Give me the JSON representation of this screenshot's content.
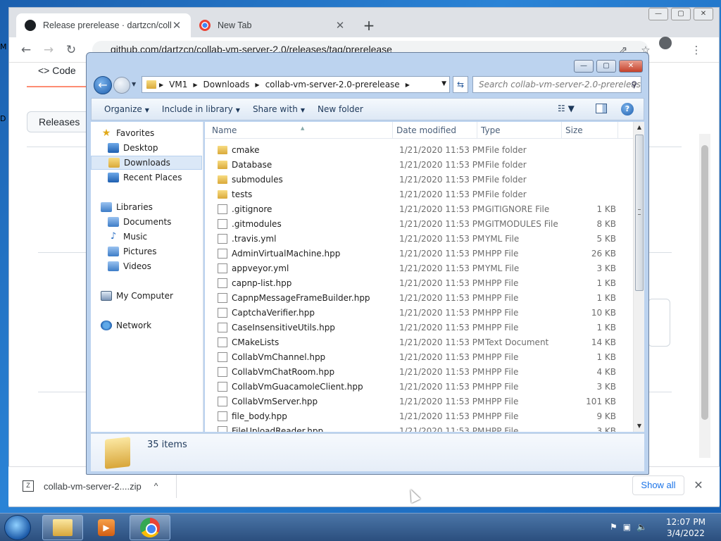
{
  "browser": {
    "tabs": [
      {
        "title": "Release prerelease · dartzcn/colla",
        "close": "✕"
      },
      {
        "title": "New Tab",
        "close": "✕"
      }
    ],
    "new_tab": "+",
    "address": "github.com/dartzcn/collab-vm-server-2.0/releases/tag/prerelease",
    "window_controls": [
      "—",
      "▢",
      "✕"
    ]
  },
  "github": {
    "code_tab": "<> Code",
    "releases_button": "Releases"
  },
  "left_edge": {
    "m": "M",
    "d": "D"
  },
  "download_bar": {
    "file": "collab-vm-server-2....zip",
    "caret": "^",
    "show_all": "Show all",
    "close": "✕"
  },
  "explorer": {
    "controls": [
      "—",
      "▢",
      "✕"
    ],
    "breadcrumb": [
      "VM1",
      "Downloads",
      "collab-vm-server-2.0-prerelease"
    ],
    "search_placeholder": "Search collab-vm-server-2.0-prerelease",
    "commands": {
      "organize": "Organize",
      "include": "Include in library",
      "share": "Share with",
      "new_folder": "New folder"
    },
    "nav": {
      "favorites": "Favorites",
      "desktop": "Desktop",
      "downloads": "Downloads",
      "recent": "Recent Places",
      "libraries": "Libraries",
      "documents": "Documents",
      "music": "Music",
      "pictures": "Pictures",
      "videos": "Videos",
      "computer": "My Computer",
      "network": "Network"
    },
    "columns": {
      "name": "Name",
      "date": "Date modified",
      "type": "Type",
      "size": "Size"
    },
    "files": [
      {
        "name": "cmake",
        "date": "1/21/2020 11:53 PM",
        "type": "File folder",
        "size": "",
        "kind": "folder"
      },
      {
        "name": "Database",
        "date": "1/21/2020 11:53 PM",
        "type": "File folder",
        "size": "",
        "kind": "folder"
      },
      {
        "name": "submodules",
        "date": "1/21/2020 11:53 PM",
        "type": "File folder",
        "size": "",
        "kind": "folder"
      },
      {
        "name": "tests",
        "date": "1/21/2020 11:53 PM",
        "type": "File folder",
        "size": "",
        "kind": "folder"
      },
      {
        "name": ".gitignore",
        "date": "1/21/2020 11:53 PM",
        "type": "GITIGNORE File",
        "size": "1 KB",
        "kind": "doc"
      },
      {
        "name": ".gitmodules",
        "date": "1/21/2020 11:53 PM",
        "type": "GITMODULES File",
        "size": "8 KB",
        "kind": "doc"
      },
      {
        "name": ".travis.yml",
        "date": "1/21/2020 11:53 PM",
        "type": "YML File",
        "size": "5 KB",
        "kind": "doc"
      },
      {
        "name": "AdminVirtualMachine.hpp",
        "date": "1/21/2020 11:53 PM",
        "type": "HPP File",
        "size": "26 KB",
        "kind": "doc"
      },
      {
        "name": "appveyor.yml",
        "date": "1/21/2020 11:53 PM",
        "type": "YML File",
        "size": "3 KB",
        "kind": "doc"
      },
      {
        "name": "capnp-list.hpp",
        "date": "1/21/2020 11:53 PM",
        "type": "HPP File",
        "size": "1 KB",
        "kind": "doc"
      },
      {
        "name": "CapnpMessageFrameBuilder.hpp",
        "date": "1/21/2020 11:53 PM",
        "type": "HPP File",
        "size": "1 KB",
        "kind": "doc"
      },
      {
        "name": "CaptchaVerifier.hpp",
        "date": "1/21/2020 11:53 PM",
        "type": "HPP File",
        "size": "10 KB",
        "kind": "doc"
      },
      {
        "name": "CaseInsensitiveUtils.hpp",
        "date": "1/21/2020 11:53 PM",
        "type": "HPP File",
        "size": "1 KB",
        "kind": "doc"
      },
      {
        "name": "CMakeLists",
        "date": "1/21/2020 11:53 PM",
        "type": "Text Document",
        "size": "14 KB",
        "kind": "doc"
      },
      {
        "name": "CollabVmChannel.hpp",
        "date": "1/21/2020 11:53 PM",
        "type": "HPP File",
        "size": "1 KB",
        "kind": "doc"
      },
      {
        "name": "CollabVmChatRoom.hpp",
        "date": "1/21/2020 11:53 PM",
        "type": "HPP File",
        "size": "4 KB",
        "kind": "doc"
      },
      {
        "name": "CollabVmGuacamoleClient.hpp",
        "date": "1/21/2020 11:53 PM",
        "type": "HPP File",
        "size": "3 KB",
        "kind": "doc"
      },
      {
        "name": "CollabVmServer.hpp",
        "date": "1/21/2020 11:53 PM",
        "type": "HPP File",
        "size": "101 KB",
        "kind": "doc"
      },
      {
        "name": "file_body.hpp",
        "date": "1/21/2020 11:53 PM",
        "type": "HPP File",
        "size": "9 KB",
        "kind": "doc"
      },
      {
        "name": "FileUploadReader.hpp",
        "date": "1/21/2020 11:53 PM",
        "type": "HPP File",
        "size": "3 KB",
        "kind": "doc"
      }
    ],
    "item_count": "35 items"
  },
  "taskbar": {
    "time": "12:07 PM",
    "date": "3/4/2022"
  }
}
